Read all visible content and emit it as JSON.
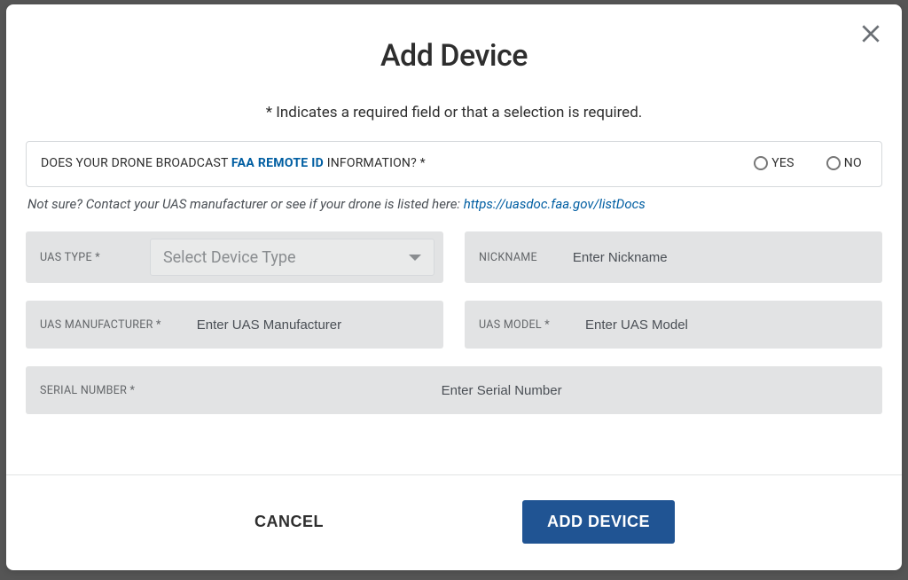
{
  "modal": {
    "title": "Add Device",
    "required_note": "* Indicates a required field or that a selection is required.",
    "broadcast": {
      "label_pre": "DOES YOUR DRONE BROADCAST ",
      "label_link": "FAA REMOTE ID",
      "label_post": " INFORMATION? *",
      "yes": "YES",
      "no": "NO"
    },
    "helper": {
      "text": "Not sure? Contact your UAS manufacturer or see if your drone is listed here: ",
      "link_text": "https://uasdoc.faa.gov/listDocs"
    },
    "fields": {
      "uas_type": {
        "label": "UAS TYPE *",
        "select_placeholder": "Select Device Type"
      },
      "nickname": {
        "label": "NICKNAME",
        "placeholder": "Enter Nickname"
      },
      "uas_manufacturer": {
        "label": "UAS MANUFACTURER *",
        "placeholder": "Enter UAS Manufacturer"
      },
      "uas_model": {
        "label": "UAS MODEL *",
        "placeholder": "Enter UAS Model"
      },
      "serial_number": {
        "label": "SERIAL NUMBER *",
        "placeholder": "Enter Serial Number"
      }
    },
    "footer": {
      "cancel": "CANCEL",
      "submit": "ADD DEVICE"
    }
  }
}
